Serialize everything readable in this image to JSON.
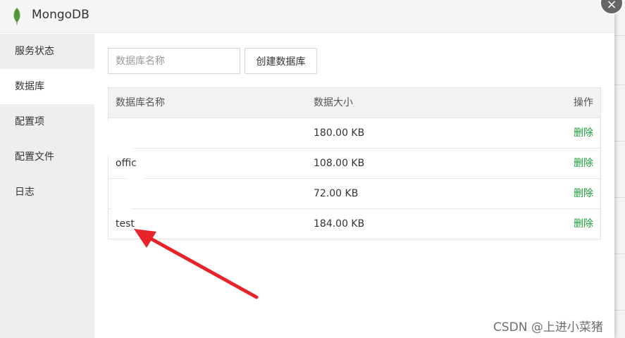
{
  "window": {
    "title": "MongoDB",
    "close_symbol": "×",
    "logo_icon": "mongodb-leaf-icon",
    "accent": "#1aa035"
  },
  "sidebar": {
    "items": [
      {
        "label": "服务状态",
        "active": false
      },
      {
        "label": "数据库",
        "active": true
      },
      {
        "label": "配置项",
        "active": false
      },
      {
        "label": "配置文件",
        "active": false
      },
      {
        "label": "日志",
        "active": false
      }
    ]
  },
  "toolbar": {
    "search_placeholder": "数据库名称",
    "search_value": "",
    "create_label": "创建数据库"
  },
  "table": {
    "headers": [
      "数据库名称",
      "数据大小",
      "操作"
    ],
    "rows": [
      {
        "name": "",
        "size": "180.00 KB",
        "action": "删除"
      },
      {
        "name": "offic",
        "size": "108.00 KB",
        "action": "删除"
      },
      {
        "name": "",
        "size": "72.00 KB",
        "action": "删除"
      },
      {
        "name": "test",
        "size": "184.00 KB",
        "action": "删除"
      }
    ]
  },
  "watermark": "CSDN @上进小菜猪"
}
